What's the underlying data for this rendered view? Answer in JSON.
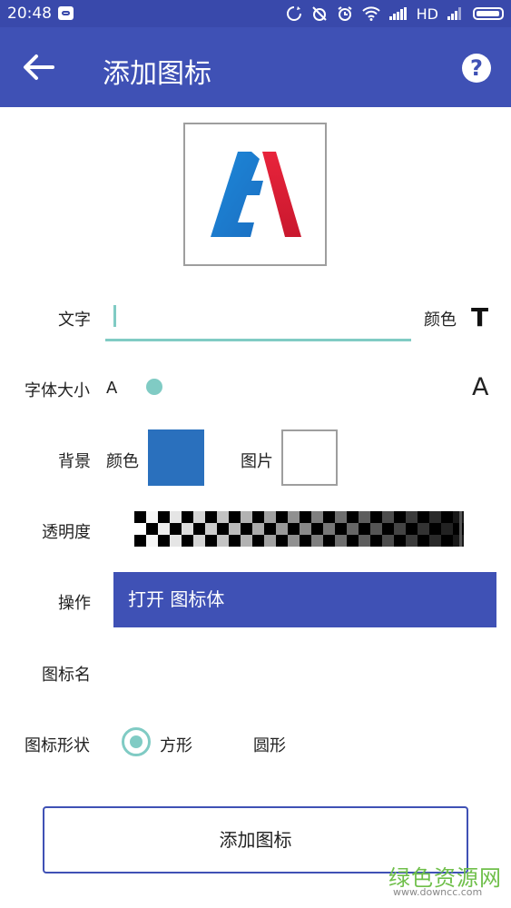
{
  "status_bar": {
    "time": "20:48",
    "network": "HD"
  },
  "app_bar": {
    "title": "添加图标",
    "help": "?"
  },
  "form": {
    "text_label": "文字",
    "text_value": "",
    "color_label": "颜色",
    "text_color_glyph": "T",
    "font_size_label": "字体大小",
    "font_size_small": "A",
    "font_size_large": "A",
    "background_label": "背景",
    "background_color_label": "颜色",
    "background_color": "#2a70bd",
    "background_image_label": "图片",
    "opacity_label": "透明度",
    "action_label": "操作",
    "action_button": "打开 图标体",
    "icon_name_label": "图标名",
    "icon_name_value": "",
    "shape_label": "图标形状",
    "shape_options": [
      "方形",
      "圆形"
    ],
    "shape_selected": "方形"
  },
  "add_button": "添加图标",
  "colors": {
    "primary": "#3f51b5",
    "status": "#3949ab",
    "accent": "#80cbc4"
  },
  "watermark": {
    "text": "绿色资源网",
    "url": "www.downcc.com"
  }
}
